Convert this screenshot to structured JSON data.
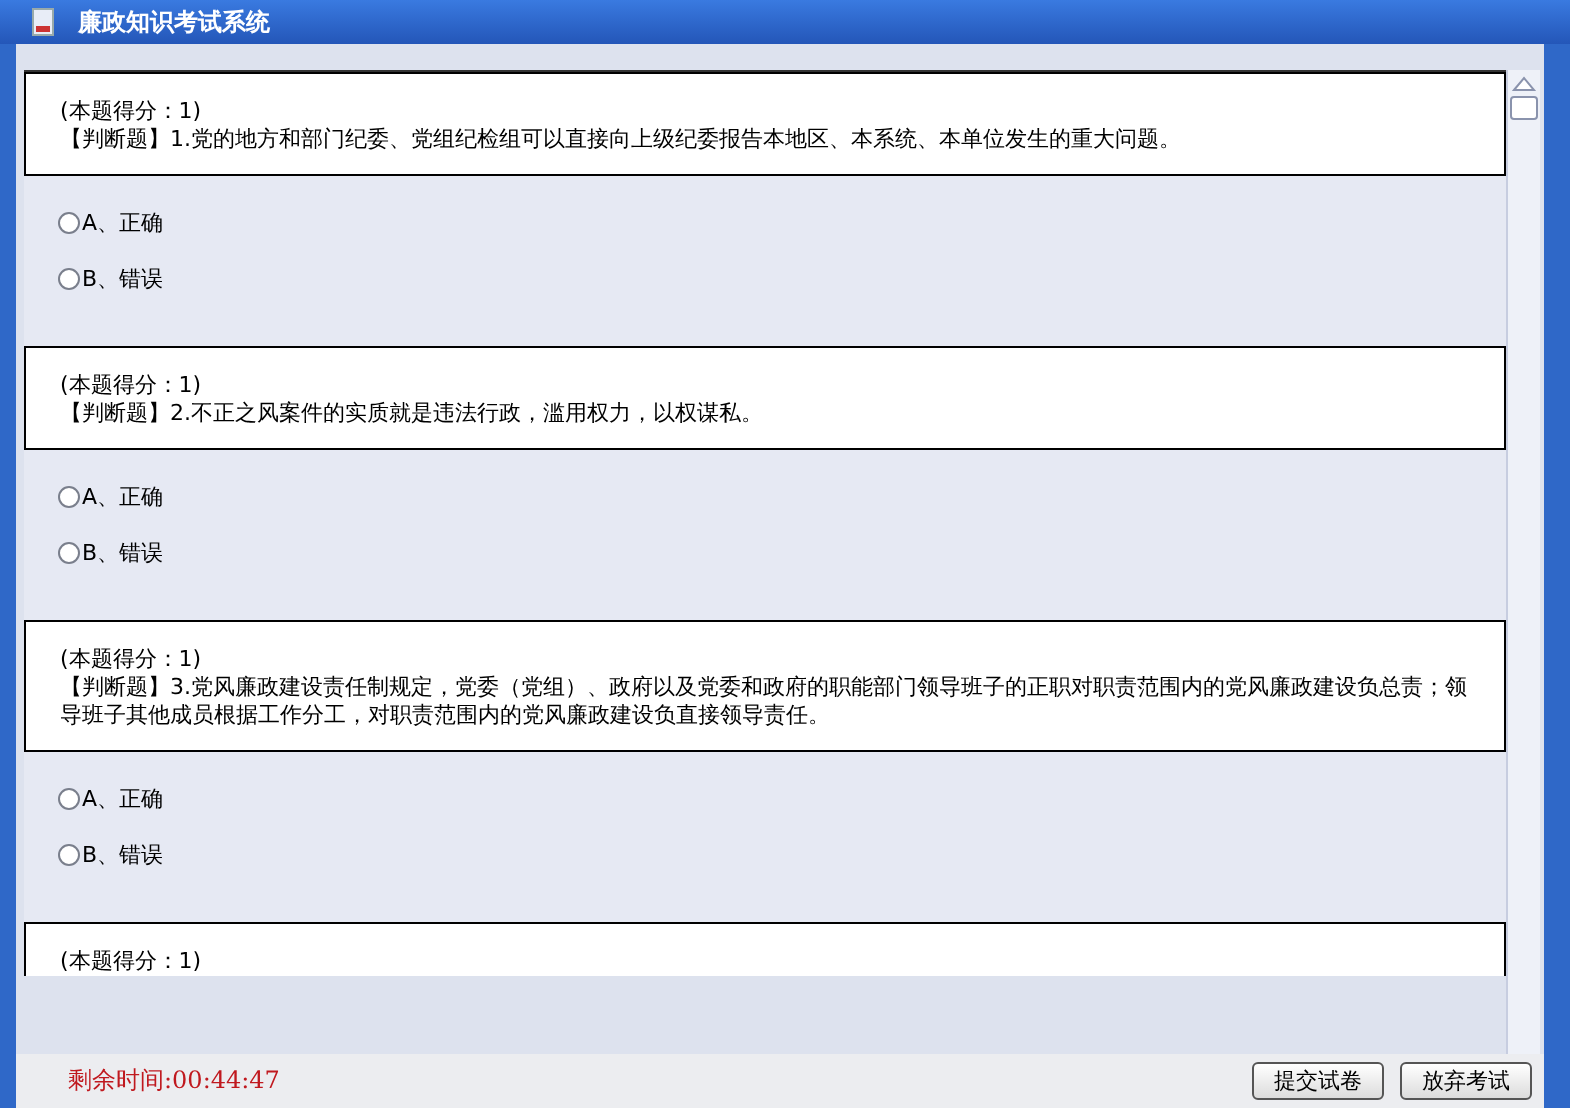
{
  "window": {
    "title": "廉政知识考试系统"
  },
  "questions": [
    {
      "score": "(本题得分：1)",
      "type_label": "【判断题】",
      "text": "1.党的地方和部门纪委、党组纪检组可以直接向上级纪委报告本地区、本系统、本单位发生的重大问题。",
      "options": [
        {
          "label": "A、正确",
          "selected": false
        },
        {
          "label": "B、错误",
          "selected": false
        }
      ]
    },
    {
      "score": "(本题得分：1)",
      "type_label": "【判断题】",
      "text": "2.不正之风案件的实质就是违法行政，滥用权力，以权谋私。",
      "options": [
        {
          "label": "A、正确",
          "selected": false
        },
        {
          "label": "B、错误",
          "selected": false
        }
      ]
    },
    {
      "score": "(本题得分：1)",
      "type_label": "【判断题】",
      "text": "3.党风廉政建设责任制规定，党委（党组）、政府以及党委和政府的职能部门领导班子的正职对职责范围内的党风廉政建设负总责；领导班子其他成员根据工作分工，对职责范围内的党风廉政建设负直接领导责任。",
      "options": [
        {
          "label": "A、正确",
          "selected": false
        },
        {
          "label": "B、错误",
          "selected": false
        }
      ]
    },
    {
      "score": "(本题得分：1)"
    }
  ],
  "footer": {
    "timer": "剩余时间:00:44:47",
    "buttons": [
      "提交试卷",
      "放弃考试"
    ]
  }
}
